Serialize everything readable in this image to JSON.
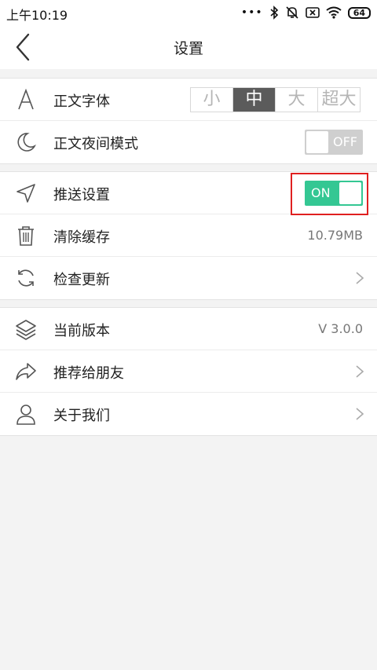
{
  "status": {
    "time": "上午10:19",
    "dots": "•••",
    "battery": "64"
  },
  "header": {
    "title": "设置"
  },
  "groups": {
    "display": {
      "font": {
        "label": "正文字体",
        "options": [
          "小",
          "中",
          "大",
          "超大"
        ],
        "selected": "中"
      },
      "night": {
        "label": "正文夜间模式",
        "toggle_state": "OFF"
      }
    },
    "general": {
      "push": {
        "label": "推送设置",
        "toggle_state": "ON"
      },
      "cache": {
        "label": "清除缓存",
        "value": "10.79MB"
      },
      "update": {
        "label": "检查更新"
      }
    },
    "about": {
      "version": {
        "label": "当前版本",
        "value": "V 3.0.0"
      },
      "share": {
        "label": "推荐给朋友"
      },
      "about_us": {
        "label": "关于我们"
      }
    }
  },
  "colors": {
    "toggle_on": "#34c793",
    "toggle_off": "#cfcfcf",
    "segment_selected": "#5b5b5b",
    "highlight": "#e02020"
  },
  "icons": {
    "font": "letter-a-icon",
    "night": "moon-icon",
    "push": "navigation-arrow-icon",
    "cache": "trash-icon",
    "update": "refresh-icon",
    "version": "layers-icon",
    "share": "share-arrow-icon",
    "about": "person-icon"
  }
}
